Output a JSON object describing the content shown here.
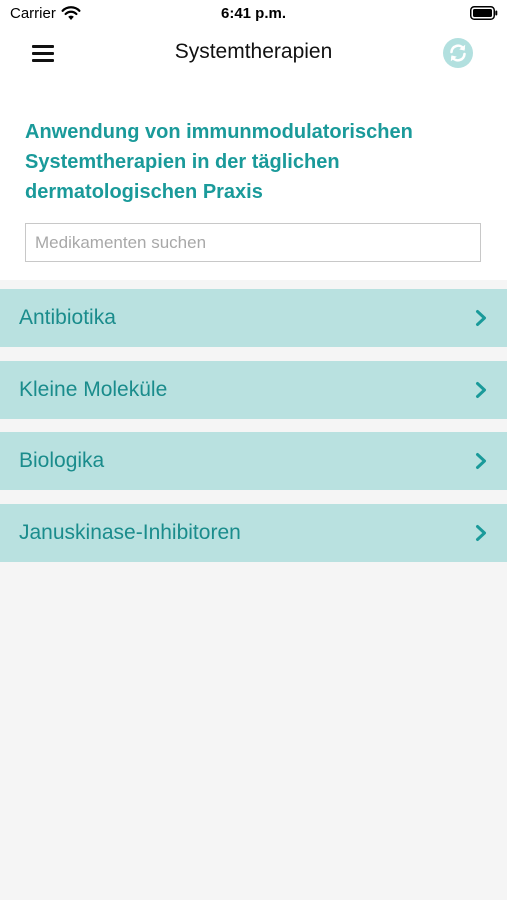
{
  "status_bar": {
    "carrier": "Carrier",
    "time": "6:41 p.m."
  },
  "nav": {
    "title": "Systemtherapien",
    "menu_icon": "hamburger-menu-icon",
    "refresh_icon": "refresh-icon"
  },
  "heading": {
    "line1": "Anwendung von immunmodulatorischen",
    "line2": "Systemtherapien in der täglichen",
    "line3": "dermatologischen Praxis"
  },
  "search": {
    "placeholder": "Medikamenten suchen",
    "value": ""
  },
  "categories": [
    {
      "label": "Antibiotika"
    },
    {
      "label": "Kleine Moleküle"
    },
    {
      "label": "Biologika"
    },
    {
      "label": "Januskinase-Inhibitoren"
    }
  ],
  "colors": {
    "accent": "#1a9a9a",
    "list_background": "#b9e1e0",
    "list_text": "#1a8c8c",
    "page_background": "#f5f5f5",
    "refresh_icon": "#b2e0df"
  }
}
